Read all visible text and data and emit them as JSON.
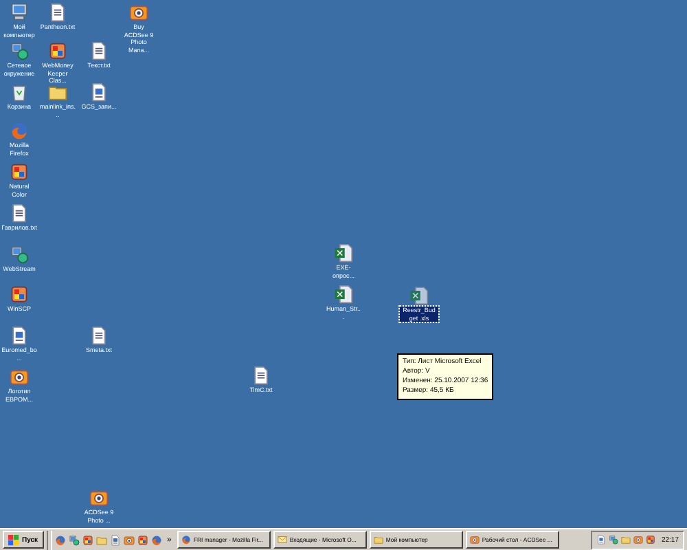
{
  "desktop": {
    "icons": [
      {
        "label": "Мой компьютер",
        "kind": "computer",
        "selected": false
      },
      {
        "label": "Pantheon.txt",
        "kind": "text",
        "selected": false
      },
      {
        "label": "Buy ACDSee 9 Photo Mana...",
        "kind": "camera",
        "selected": false
      },
      {
        "label": "Сетевое окружение",
        "kind": "network",
        "selected": false
      },
      {
        "label": "WebMoney Keeper Clas...",
        "kind": "app",
        "selected": false
      },
      {
        "label": "Текст.txt",
        "kind": "text",
        "selected": false
      },
      {
        "label": "Корзина",
        "kind": "recycle",
        "selected": false
      },
      {
        "label": "mainlink_ins...",
        "kind": "folder",
        "selected": false
      },
      {
        "label": "GCS_запи...",
        "kind": "doc",
        "selected": false
      },
      {
        "label": "Mozilla Firefox",
        "kind": "firefox",
        "selected": false
      },
      {
        "label": "Natural Color",
        "kind": "app",
        "selected": false
      },
      {
        "label": "Гаврилов.txt",
        "kind": "text",
        "selected": false
      },
      {
        "label": "WebStream",
        "kind": "network",
        "selected": false
      },
      {
        "label": "WinSCP",
        "kind": "app",
        "selected": false
      },
      {
        "label": "Euromed_bo...",
        "kind": "doc",
        "selected": false
      },
      {
        "label": "Smeta.txt",
        "kind": "text",
        "selected": false
      },
      {
        "label": "Логотип ЕВРОМ...",
        "kind": "camera",
        "selected": false
      },
      {
        "label": "EXE-опрос...",
        "kind": "excel",
        "selected": false
      },
      {
        "label": "Human_Str...",
        "kind": "excel",
        "selected": false
      },
      {
        "label": "Reestr_Budget .xls",
        "kind": "excel",
        "selected": true
      },
      {
        "label": "TimC.txt",
        "kind": "text",
        "selected": false
      },
      {
        "label": "ACDSee 9 Photo ...",
        "kind": "camera",
        "selected": false
      }
    ],
    "tooltip": [
      "Тип: Лист Microsoft Excel",
      "Автор: V",
      "Изменен: 25.10.2007 12:36",
      "Размер: 45,5 КБ"
    ]
  },
  "taskbar": {
    "start": "Пуск",
    "more": "»",
    "tasks": [
      {
        "label": "FRI manager - Mozilla Fir...",
        "kind": "firefox",
        "selected": false
      },
      {
        "label": "Входящие - Microsoft O...",
        "kind": "mail",
        "selected": false
      },
      {
        "label": "Мой компьютер",
        "kind": "folder",
        "selected": false
      },
      {
        "label": "Рабочий стол - ACDSee ...",
        "kind": "camera",
        "selected": false
      }
    ],
    "clock": "22:17"
  }
}
